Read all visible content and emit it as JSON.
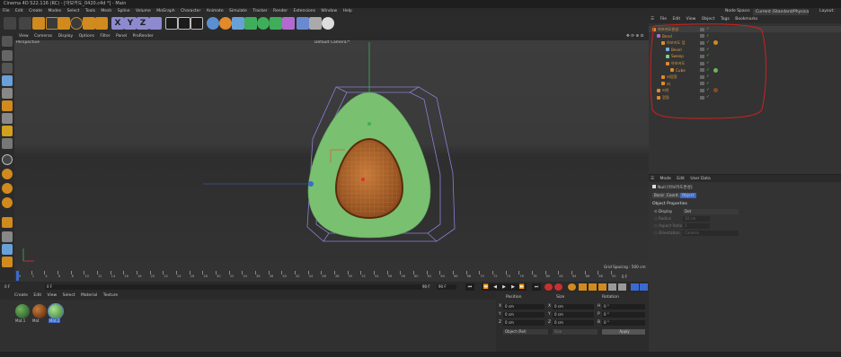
{
  "window": {
    "title": "Cinema 4D S22.116 (RC) - [아보카도_0420.c4d *] - Main"
  },
  "menubar": {
    "items": [
      "File",
      "Edit",
      "Create",
      "Modes",
      "Select",
      "Tools",
      "Mesh",
      "Spline",
      "Volume",
      "MoGraph",
      "Character",
      "Animate",
      "Simulate",
      "Tracker",
      "Render",
      "Extensions",
      "Window",
      "Help"
    ],
    "node_space_label": "Node Space:",
    "node_space_value": "Current (Standard/Physical)",
    "layout_label": "Layout:"
  },
  "toolbar": {
    "axis_x": "X",
    "axis_y": "Y",
    "axis_z": "Z"
  },
  "viewport": {
    "menu": [
      "View",
      "Cameras",
      "Display",
      "Options",
      "Filter",
      "Panel",
      "ProRender"
    ],
    "view_name": "Perspective",
    "camera": "Default Camera:*",
    "grid_spacing": "Grid Spacing : 500 cm",
    "colors": {
      "avocado_flesh": "#79c070",
      "seed": "#b5692a",
      "bbox": "#8b7fd6"
    }
  },
  "timeline": {
    "ticks": [
      "0",
      "2",
      "4",
      "6",
      "8",
      "10",
      "12",
      "14",
      "16",
      "18",
      "20",
      "22",
      "24",
      "26",
      "28",
      "30",
      "32",
      "34",
      "36",
      "38",
      "40",
      "42",
      "44",
      "46",
      "48",
      "50",
      "52",
      "54",
      "56",
      "58",
      "60",
      "62",
      "64",
      "66",
      "68",
      "70",
      "72",
      "74",
      "76",
      "78",
      "80",
      "82",
      "84",
      "86",
      "88",
      "90"
    ],
    "end_label": "0 F"
  },
  "transport": {
    "current_frame": "0 F",
    "start_field": "0 F",
    "end_field": "90 F",
    "end_field2": "90 F"
  },
  "material_manager": {
    "menu": [
      "Create",
      "Edit",
      "View",
      "Select",
      "Material",
      "Texture"
    ],
    "materials": [
      {
        "name": "Mat.1",
        "color": "#2e6a33"
      },
      {
        "name": "Mat",
        "color": "#8a4a1e"
      },
      {
        "name": "Mat.2",
        "color": "#6fb35e"
      }
    ]
  },
  "coordinates": {
    "headers": [
      "Position",
      "Size",
      "Rotation"
    ],
    "rows": [
      {
        "axis": "X",
        "pos": "0 cm",
        "size_axis": "X",
        "size": "0 cm",
        "rot_axis": "H",
        "rot": "0 °"
      },
      {
        "axis": "Y",
        "pos": "0 cm",
        "size_axis": "Y",
        "size": "0 cm",
        "rot_axis": "P",
        "rot": "0 °"
      },
      {
        "axis": "Z",
        "pos": "0 cm",
        "size_axis": "Z",
        "size": "0 cm",
        "rot_axis": "B",
        "rot": "0 °"
      }
    ],
    "mode": "Object (Rel)",
    "size_mode": "Size",
    "apply": "Apply"
  },
  "object_manager": {
    "menu": [
      "File",
      "Edit",
      "View",
      "Object",
      "Tags",
      "Bookmarks"
    ],
    "objects": [
      {
        "name": "아보카도완성",
        "level": 0,
        "color": "#e08a2a"
      },
      {
        "name": "Bend",
        "level": 1,
        "color": "#b06ad0"
      },
      {
        "name": "아보카도 껍",
        "level": 2,
        "color": "#e08a2a"
      },
      {
        "name": "Bevel",
        "level": 3,
        "color": "#7fb0e0"
      },
      {
        "name": "Sweep",
        "level": 3,
        "color": "#7fd07f"
      },
      {
        "name": "아보카도",
        "level": 3,
        "color": "#e08a2a"
      },
      {
        "name": "Cube",
        "level": 4,
        "color": "#e08a2a"
      },
      {
        "name": "씨껍질",
        "level": 2,
        "color": "#e08a2a"
      },
      {
        "name": "씨",
        "level": 2,
        "color": "#e08a2a"
      },
      {
        "name": "씨앗",
        "level": 1,
        "color": "#e08a2a"
      },
      {
        "name": "껍질",
        "level": 1,
        "color": "#e08a2a"
      }
    ]
  },
  "attributes": {
    "menu": [
      "Mode",
      "Edit",
      "User Data"
    ],
    "object_title": "Null [아보카도완성]",
    "tabs": [
      "Basic",
      "Coord.",
      "Object"
    ],
    "section": "Object Properties",
    "fields": [
      {
        "label": "Display",
        "value": "Dot"
      },
      {
        "label": "Radius",
        "value": "10 cm"
      },
      {
        "label": "Aspect Ratio",
        "value": "1"
      },
      {
        "label": "Orientation",
        "value": "Camera"
      }
    ]
  }
}
